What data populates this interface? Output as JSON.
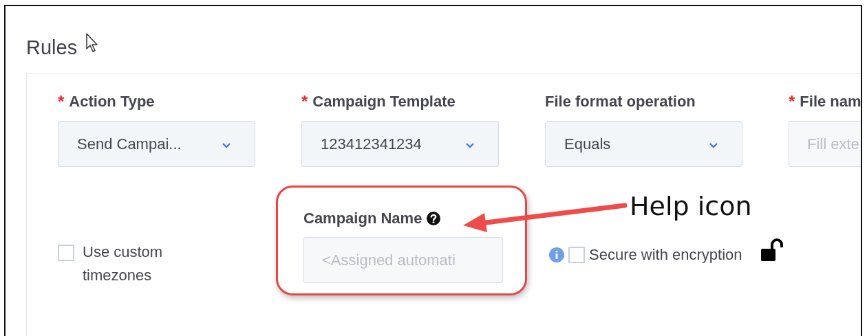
{
  "section": {
    "title": "Rules"
  },
  "fields": [
    {
      "label": "Action Type",
      "required_mark": "*",
      "kind": "dropdown",
      "value": "Send Campai..."
    },
    {
      "label": "Campaign Template",
      "required_mark": "*",
      "kind": "dropdown",
      "value": "123412341234"
    },
    {
      "label": "File format operation",
      "kind": "dropdown",
      "value": "Equals"
    },
    {
      "label": "File nam",
      "required_mark": "*",
      "kind": "text",
      "placeholder": "Fill exte"
    }
  ],
  "custom_timezones": {
    "label": "Use custom timezones",
    "checked": false
  },
  "campaign_name": {
    "label": "Campaign Name",
    "placeholder": "<Assigned automati"
  },
  "encryption": {
    "label": "Secure with encryption",
    "checked": false
  },
  "annotation": {
    "text": "Help icon"
  }
}
